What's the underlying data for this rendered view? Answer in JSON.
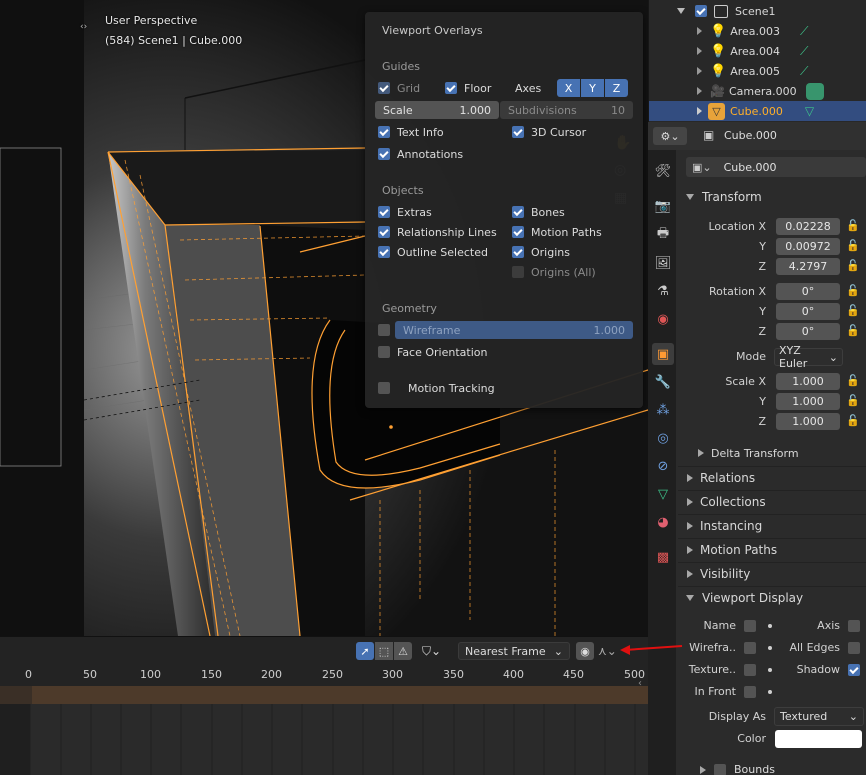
{
  "viewport": {
    "perspective_label": "User Perspective",
    "scene_info": "(584) Scene1 | Cube.000"
  },
  "overlays": {
    "title": "Viewport Overlays",
    "guides": {
      "heading": "Guides",
      "grid": {
        "label": "Grid",
        "checked": true
      },
      "floor": {
        "label": "Floor",
        "checked": true
      },
      "axes_label": "Axes",
      "axes": [
        "X",
        "Y",
        "Z"
      ],
      "scale_label": "Scale",
      "scale_value": "1.000",
      "subdivisions_label": "Subdivisions",
      "subdivisions_value": "10",
      "text_info": {
        "label": "Text Info",
        "checked": true
      },
      "cursor_3d": {
        "label": "3D Cursor",
        "checked": true
      },
      "annotations": {
        "label": "Annotations",
        "checked": true
      }
    },
    "objects": {
      "heading": "Objects",
      "extras": {
        "label": "Extras",
        "checked": true
      },
      "bones": {
        "label": "Bones",
        "checked": true
      },
      "relationship_lines": {
        "label": "Relationship Lines",
        "checked": true
      },
      "motion_paths": {
        "label": "Motion Paths",
        "checked": true
      },
      "outline_selected": {
        "label": "Outline Selected",
        "checked": true
      },
      "origins": {
        "label": "Origins",
        "checked": true
      },
      "origins_all": {
        "label": "Origins (All)",
        "checked": false
      }
    },
    "geometry": {
      "heading": "Geometry",
      "wireframe_label": "Wireframe",
      "wireframe_value": "1.000",
      "face_orientation": {
        "label": "Face Orientation",
        "checked": false
      }
    },
    "motion_tracking": {
      "label": "Motion Tracking",
      "checked": false
    }
  },
  "timeline": {
    "snap_label": "Nearest Frame",
    "ticks": [
      "0",
      "50",
      "100",
      "150",
      "200",
      "250",
      "300",
      "350",
      "400",
      "450",
      "500"
    ]
  },
  "outliner": {
    "items": [
      {
        "name": "Scene1",
        "icon": "scene-icon"
      },
      {
        "name": "Area.003",
        "icon": "light-icon"
      },
      {
        "name": "Area.004",
        "icon": "light-icon"
      },
      {
        "name": "Area.005",
        "icon": "light-icon"
      },
      {
        "name": "Camera.000",
        "icon": "camera-icon"
      },
      {
        "name": "Cube.000",
        "icon": "mesh-icon",
        "selected": true
      }
    ]
  },
  "properties": {
    "object_name": "Cube.000",
    "object_name_field": "Cube.000",
    "transform": {
      "heading": "Transform",
      "location_label": "Location X",
      "y_label": "Y",
      "z_label": "Z",
      "location": [
        "0.02228",
        "0.00972",
        "4.2797"
      ],
      "rotation_label": "Rotation X",
      "rotation": [
        "0°",
        "0°",
        "0°"
      ],
      "mode_label": "Mode",
      "mode_value": "XYZ Euler",
      "scale_label": "Scale X",
      "scale": [
        "1.000",
        "1.000",
        "1.000"
      ],
      "delta": "Delta Transform"
    },
    "sections": [
      "Relations",
      "Collections",
      "Instancing",
      "Motion Paths",
      "Visibility"
    ],
    "viewport_display": {
      "heading": "Viewport Display",
      "name": {
        "label": "Name",
        "checked": false
      },
      "axis": {
        "label": "Axis",
        "checked": false
      },
      "wireframe": {
        "label": "Wirefra..",
        "checked": false
      },
      "all_edges": {
        "label": "All Edges",
        "checked": false
      },
      "texture_space": {
        "label": "Texture..",
        "checked": false
      },
      "shadow": {
        "label": "Shadow",
        "checked": true
      },
      "in_front": {
        "label": "In Front",
        "checked": false
      },
      "display_as_label": "Display As",
      "display_as_value": "Textured",
      "color_label": "Color",
      "color_value": "#ffffff",
      "bounds": {
        "label": "Bounds",
        "checked": false
      }
    }
  },
  "colors": {
    "accent_blue": "#4772b3",
    "selection_orange": "#ffa033",
    "annotation_red": "#e01010"
  }
}
